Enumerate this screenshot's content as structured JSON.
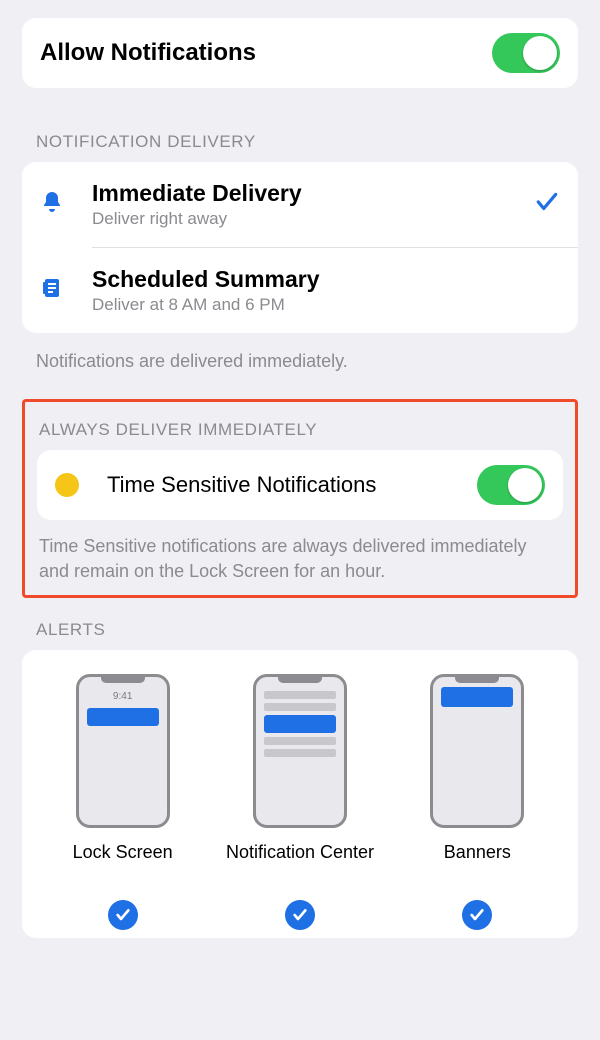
{
  "allow": {
    "title": "Allow Notifications",
    "on": true
  },
  "delivery": {
    "header": "NOTIFICATION DELIVERY",
    "immediate": {
      "title": "Immediate Delivery",
      "subtitle": "Deliver right away",
      "selected": true
    },
    "scheduled": {
      "title": "Scheduled Summary",
      "subtitle": "Deliver at 8 AM and 6 PM",
      "selected": false
    },
    "footer": "Notifications are delivered immediately."
  },
  "timeSensitive": {
    "header": "ALWAYS DELIVER IMMEDIATELY",
    "title": "Time Sensitive Notifications",
    "on": true,
    "footer": "Time Sensitive notifications are always delivered immediately and remain on the Lock Screen for an hour."
  },
  "alerts": {
    "header": "ALERTS",
    "previewTime": "9:41",
    "options": [
      {
        "label": "Lock Screen",
        "checked": true
      },
      {
        "label": "Notification Center",
        "checked": true
      },
      {
        "label": "Banners",
        "checked": true
      }
    ]
  }
}
